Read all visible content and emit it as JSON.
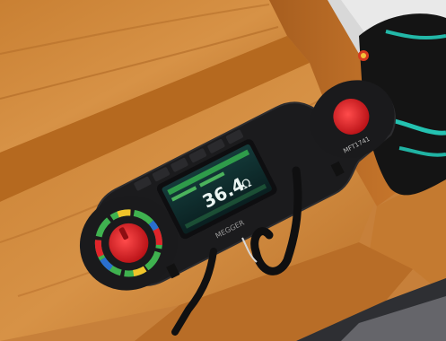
{
  "scene": {
    "description_ref": "photo",
    "device": {
      "brand_label": "MEGGER",
      "model_label": "MFT1741",
      "display": {
        "reading_value": "36.4",
        "reading_unit": "Ω"
      }
    },
    "colors": {
      "wood_light": "#d08a3a",
      "wood_dark": "#9a5a1e",
      "device_body": "#1b1b1d",
      "screen_bg": "#0c2a2a",
      "accent_red": "#e0242a",
      "accent_green": "#3fb24f"
    }
  }
}
